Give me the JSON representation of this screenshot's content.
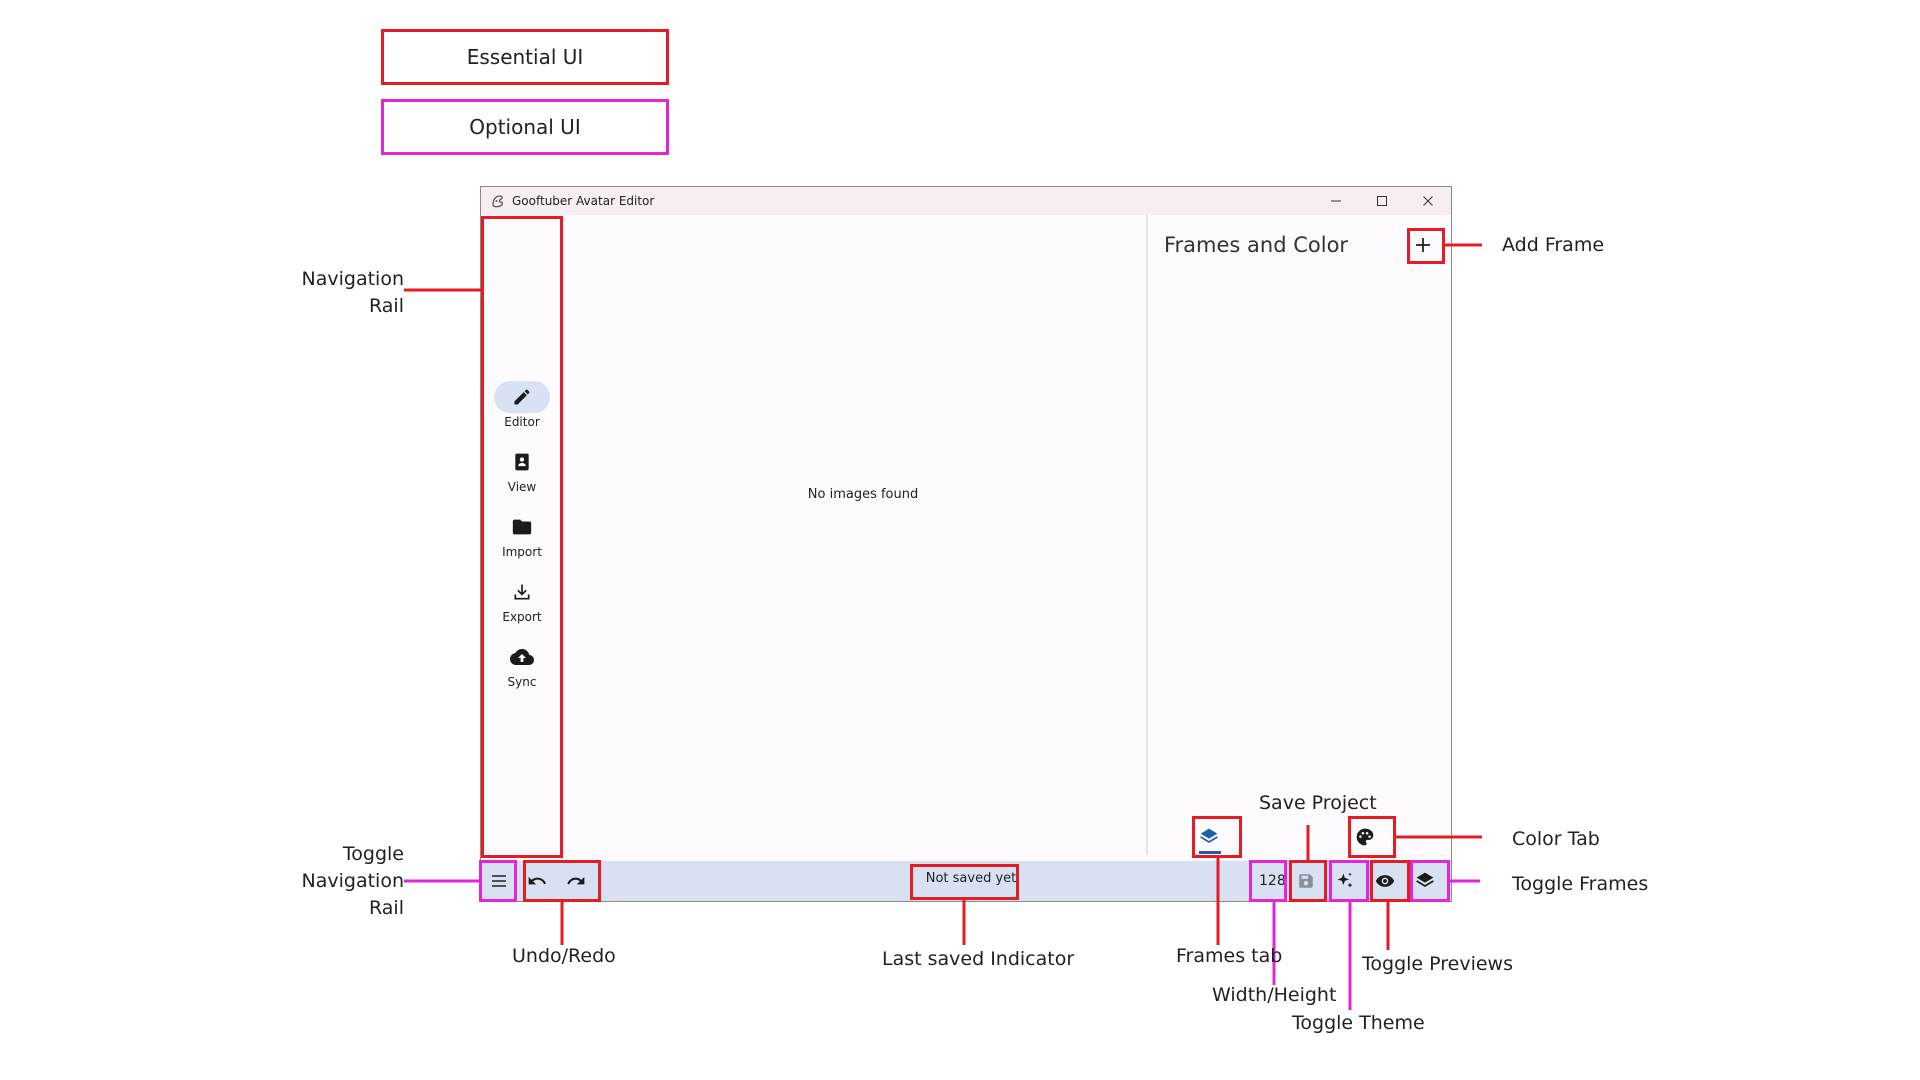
{
  "legend": {
    "essential": "Essential UI",
    "optional": "Optional UI"
  },
  "window": {
    "title": "Gooftuber Avatar Editor",
    "controls": [
      "minimize-icon",
      "maximize-icon",
      "close-icon"
    ]
  },
  "nav_rail": {
    "items": [
      {
        "label": "Editor",
        "icon": "pencil-icon",
        "active": true
      },
      {
        "label": "View",
        "icon": "portrait-icon",
        "active": false
      },
      {
        "label": "Import",
        "icon": "folder-icon",
        "active": false
      },
      {
        "label": "Export",
        "icon": "download-icon",
        "active": false
      },
      {
        "label": "Sync",
        "icon": "cloud-upload-icon",
        "active": false
      }
    ]
  },
  "canvas": {
    "message": "No images found"
  },
  "side_panel": {
    "title": "Frames and Color",
    "add_icon": "plus-icon"
  },
  "bottom_bar": {
    "status": "Not saved yet",
    "dimension": "128"
  },
  "annotations": {
    "navigation_rail": [
      "Navigation",
      "Rail"
    ],
    "toggle_navigation_rail": [
      "Toggle",
      "Navigation",
      "Rail"
    ],
    "undo_redo": "Undo/Redo",
    "last_saved": "Last saved Indicator",
    "frames_tab": "Frames tab",
    "width_height": "Width/Height",
    "toggle_theme": "Toggle Theme",
    "save_project": "Save Project",
    "toggle_previews": "Toggle Previews",
    "color_tab": "Color Tab",
    "toggle_frames": "Toggle Frames",
    "add_frame": "Add Frame"
  },
  "colors": {
    "essential": "#e41c23",
    "optional": "#e225d8",
    "bottom_bar": "#d7e1f2",
    "active_nav": "#d8e2f4",
    "accent": "#1f5fa8"
  }
}
